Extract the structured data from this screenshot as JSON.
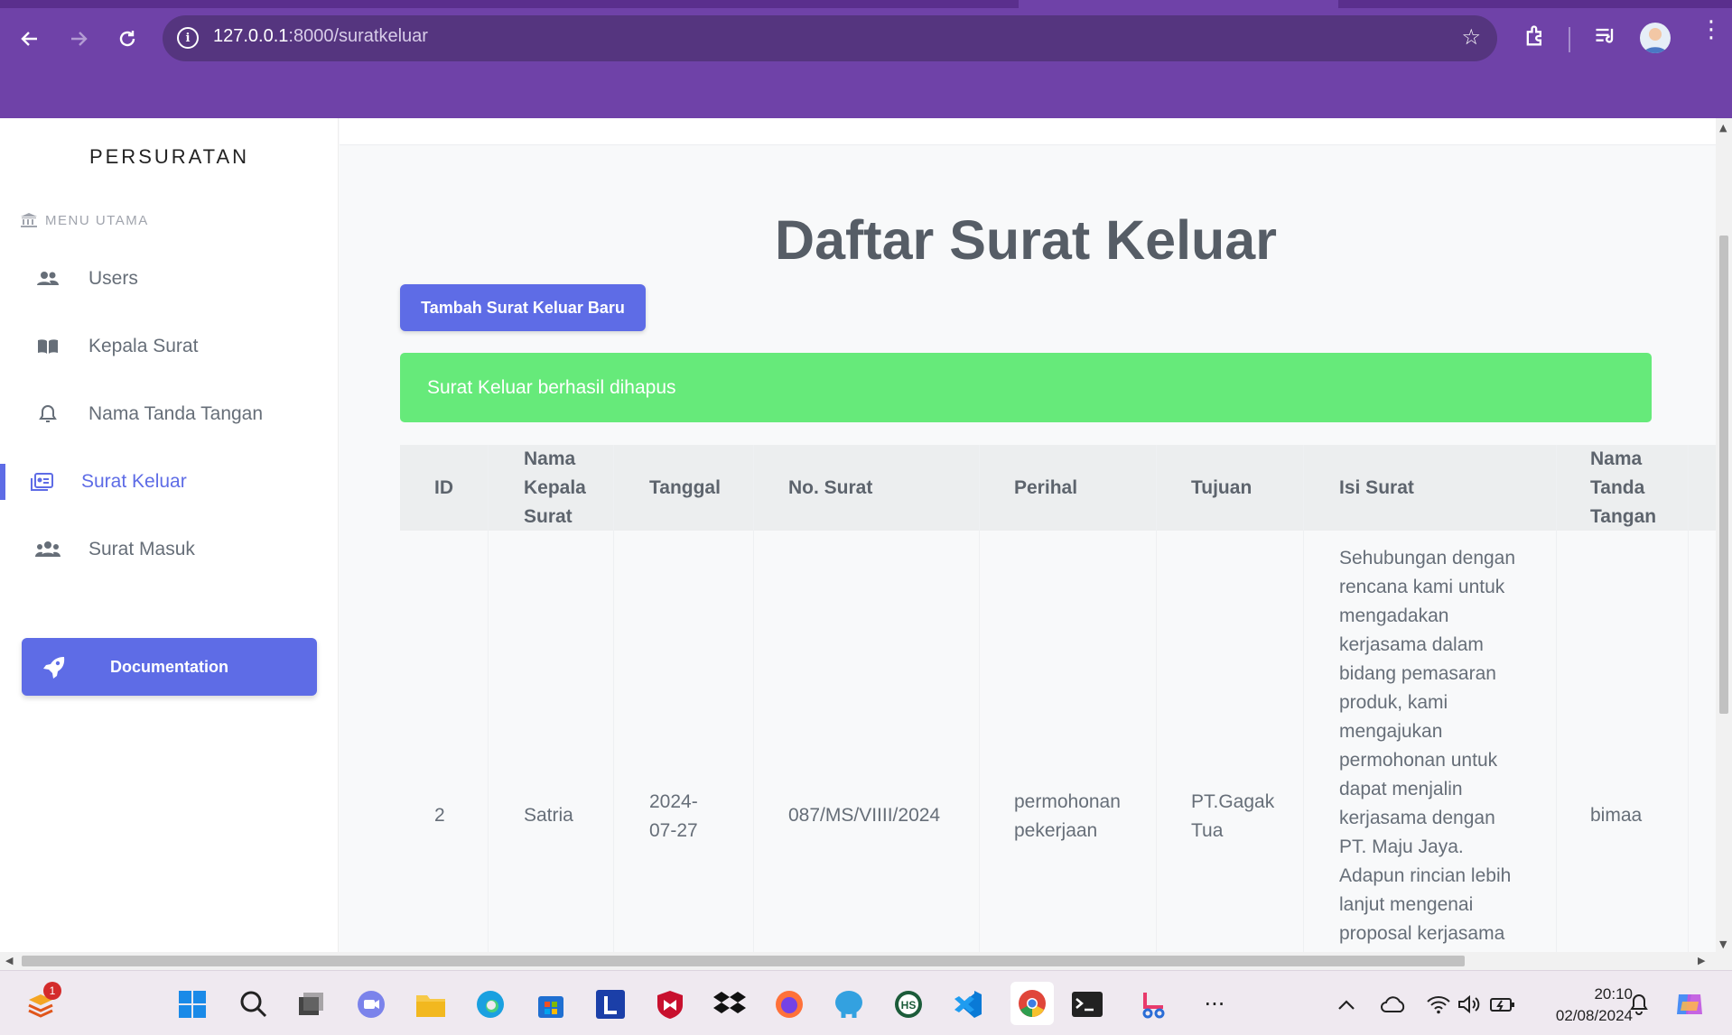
{
  "browser": {
    "url_host": "127.0.0.1",
    "url_path": ":8000/suratkeluar"
  },
  "sidebar": {
    "brand": "PERSURATAN",
    "menu_title": "MENU UTAMA",
    "items": [
      {
        "label": "Users",
        "icon": "users-icon"
      },
      {
        "label": "Kepala Surat",
        "icon": "book-icon"
      },
      {
        "label": "Nama Tanda Tangan",
        "icon": "bell-icon"
      },
      {
        "label": "Surat Keluar",
        "icon": "id-card-icon",
        "active": true
      },
      {
        "label": "Surat Masuk",
        "icon": "users-icon"
      }
    ],
    "doc_button": "Documentation"
  },
  "main": {
    "title": "Daftar Surat Keluar",
    "add_button": "Tambah Surat Keluar Baru",
    "alert": "Surat Keluar berhasil dihapus",
    "table": {
      "headers": {
        "id": "ID",
        "kepala": "Nama Kepala Surat",
        "tanggal": "Tanggal",
        "no": "No. Surat",
        "perihal": "Perihal",
        "tujuan": "Tujuan",
        "isi": "Isi Surat",
        "ttd": "Nama Tanda Tangan"
      },
      "rows": [
        {
          "id": "2",
          "kepala": "Satria",
          "tanggal": "2024-07-27",
          "no": "087/MS/VIIII/2024",
          "perihal": "permohonan pekerjaan",
          "tujuan": "PT.Gagak Tua",
          "isi": "Sehubungan dengan rencana kami untuk mengadakan kerjasama dalam bidang pemasaran produk, kami mengajukan permohonan untuk dapat menjalin kerjasama dengan PT. Maju Jaya. Adapun rincian lebih lanjut mengenai proposal kerjasama tersebut terlampir",
          "ttd": "bimaa"
        }
      ]
    }
  },
  "taskbar": {
    "time": "20:10",
    "date": "02/08/2024",
    "badge_count": "1"
  },
  "colors": {
    "chrome": "#6f42a8",
    "accent": "#5e6ce6",
    "alert": "#66ea7a"
  }
}
